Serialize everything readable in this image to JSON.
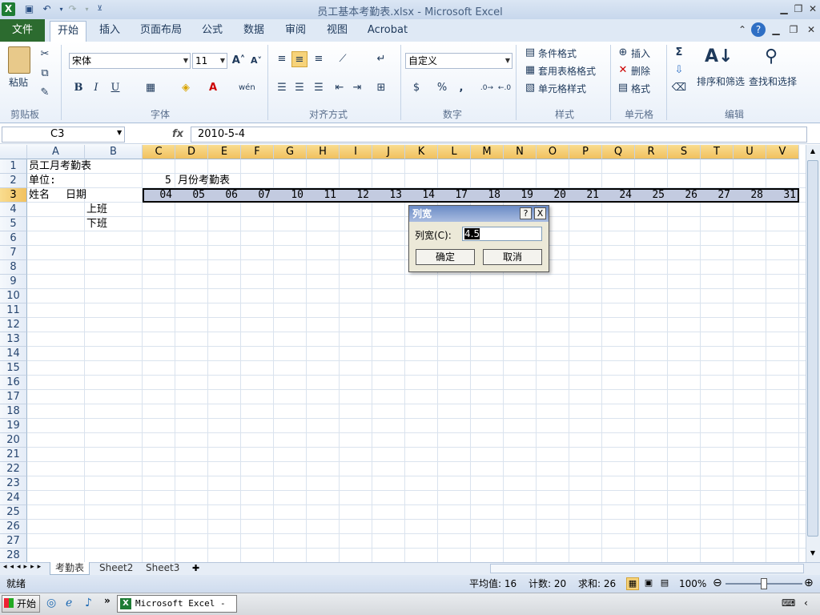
{
  "window": {
    "title": "员工基本考勤表.xlsx - Microsoft Excel"
  },
  "ribbon": {
    "file_tab": "文件",
    "tabs": [
      "开始",
      "插入",
      "页面布局",
      "公式",
      "数据",
      "审阅",
      "视图",
      "Acrobat"
    ],
    "groups": {
      "clipboard": "剪贴板",
      "font": "字体",
      "alignment": "对齐方式",
      "number": "数字",
      "styles": "样式",
      "cells": "单元格",
      "editing": "编辑"
    },
    "paste_label": "粘贴",
    "font_name": "宋体",
    "font_size": "11",
    "number_format": "自定义",
    "cond_format": "条件格式",
    "table_format": "套用表格格式",
    "cell_styles": "单元格样式",
    "insert": "插入",
    "delete": "删除",
    "format": "格式",
    "sort_filter": "排序和筛选",
    "find_select": "查找和选择",
    "bold": "B",
    "italic": "I",
    "underline": "U",
    "percent": "%",
    "comma": ","
  },
  "formula_bar": {
    "name_box": "C3",
    "fx": "fx",
    "content": "2010-5-4"
  },
  "grid": {
    "columns": [
      "A",
      "B",
      "C",
      "D",
      "E",
      "F",
      "G",
      "H",
      "I",
      "J",
      "K",
      "L",
      "M",
      "N",
      "O",
      "P",
      "Q",
      "R",
      "S",
      "T",
      "U",
      "V"
    ],
    "rows": [
      "1",
      "2",
      "3",
      "4",
      "5",
      "6",
      "7",
      "8",
      "9",
      "10",
      "11",
      "12",
      "13",
      "14",
      "15",
      "16",
      "17",
      "18",
      "19",
      "20",
      "21",
      "22",
      "23",
      "24",
      "25",
      "26",
      "27",
      "28"
    ],
    "cells": {
      "a1": "员工月考勤表",
      "a2": "单位:",
      "c2": "5",
      "d2": "月份考勤表",
      "a3": "姓名",
      "a3b": "日期",
      "b4": "上班",
      "b5": "下班"
    },
    "row3_days": [
      "04",
      "05",
      "06",
      "07",
      "10",
      "11",
      "12",
      "13",
      "14",
      "17",
      "18",
      "19",
      "20",
      "21",
      "24",
      "25",
      "26",
      "27",
      "28",
      "31"
    ]
  },
  "sheets": [
    "考勤表",
    "Sheet2",
    "Sheet3"
  ],
  "status": {
    "ready": "就绪",
    "average": "平均值: 16",
    "count": "计数: 20",
    "sum": "求和: 26",
    "zoom": "100%"
  },
  "dialog": {
    "title": "列宽",
    "help": "?",
    "close": "X",
    "label": "列宽(C):",
    "value": "4.5",
    "ok": "确定",
    "cancel": "取消"
  },
  "taskbar": {
    "start": "开始",
    "task": "Microsoft Excel - ..."
  }
}
